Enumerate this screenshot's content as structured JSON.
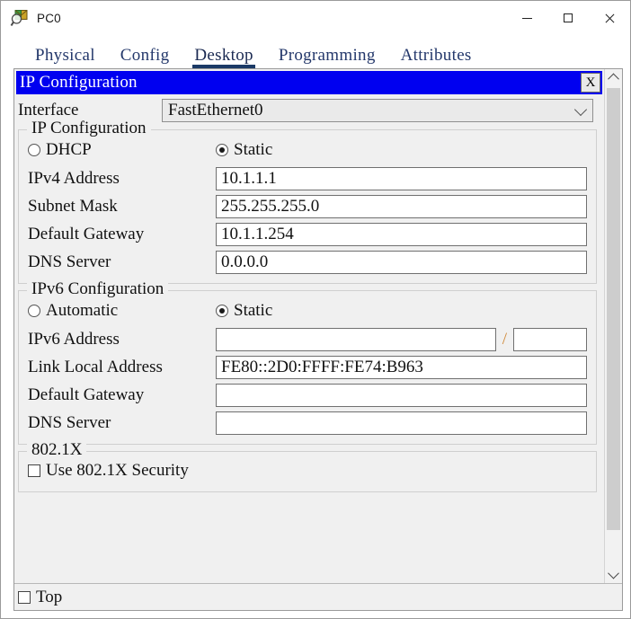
{
  "window": {
    "title": "PC0",
    "icon": "packet-tracer-pc-icon",
    "minimize_label": "–",
    "maximize_label": "□",
    "close_label": "×"
  },
  "tabs": [
    {
      "label": "Physical",
      "active": false
    },
    {
      "label": "Config",
      "active": false
    },
    {
      "label": "Desktop",
      "active": true
    },
    {
      "label": "Programming",
      "active": false
    },
    {
      "label": "Attributes",
      "active": false
    }
  ],
  "inner_window": {
    "caption": "IP Configuration",
    "close_label": "X",
    "caption_bg": "#0000f0",
    "caption_fg": "#ffffff"
  },
  "interface": {
    "label": "Interface",
    "value": "FastEthernet0",
    "arrow_icon": "chevron-down-icon"
  },
  "ipv4": {
    "group_title": "IP Configuration",
    "mode": {
      "dhcp_label": "DHCP",
      "dhcp_selected": false,
      "static_label": "Static",
      "static_selected": true
    },
    "fields": [
      {
        "label": "IPv4 Address",
        "value": "10.1.1.1"
      },
      {
        "label": "Subnet Mask",
        "value": "255.255.255.0"
      },
      {
        "label": "Default Gateway",
        "value": "10.1.1.254"
      },
      {
        "label": "DNS Server",
        "value": "0.0.0.0"
      }
    ]
  },
  "ipv6": {
    "group_title": "IPv6 Configuration",
    "mode": {
      "automatic_label": "Automatic",
      "automatic_selected": false,
      "static_label": "Static",
      "static_selected": true
    },
    "address": {
      "label": "IPv6 Address",
      "value": "",
      "separator": "/",
      "prefix_length": ""
    },
    "fields": [
      {
        "label": "Link Local Address",
        "value": "FE80::2D0:FFFF:FE74:B963"
      },
      {
        "label": "Default Gateway",
        "value": ""
      },
      {
        "label": "DNS Server",
        "value": ""
      }
    ]
  },
  "dot1x": {
    "group_title": "802.1X",
    "use_label": "Use 802.1X Security",
    "use_checked": false
  },
  "bottom": {
    "top_label": "Top",
    "top_checked": false
  },
  "scrollbar": {
    "up_icon": "chevron-up-icon",
    "down_icon": "chevron-down-icon"
  }
}
